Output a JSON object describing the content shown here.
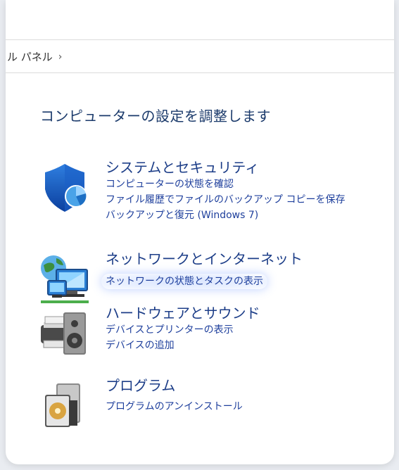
{
  "breadcrumb": {
    "label": "ル パネル",
    "separator": "›"
  },
  "page_title": "コンピューターの設定を調整します",
  "categories": [
    {
      "title": "システムとセキュリティ",
      "icon": "shield-icon",
      "links": [
        "コンピューターの状態を確認",
        "ファイル履歴でファイルのバックアップ コピーを保存",
        "バックアップと復元 (Windows 7)"
      ]
    },
    {
      "title": "ネットワークとインターネット",
      "icon": "network-icon",
      "links": [
        "ネットワークの状態とタスクの表示"
      ]
    },
    {
      "title": "ハードウェアとサウンド",
      "icon": "printer-speaker-icon",
      "links": [
        "デバイスとプリンターの表示",
        "デバイスの追加"
      ]
    },
    {
      "title": "プログラム",
      "icon": "programs-icon",
      "links": [
        "プログラムのアンインストール"
      ]
    }
  ],
  "colors": {
    "link": "#1e3f9c",
    "title": "#1b3a6b",
    "highlight": "#7aa0ff"
  }
}
